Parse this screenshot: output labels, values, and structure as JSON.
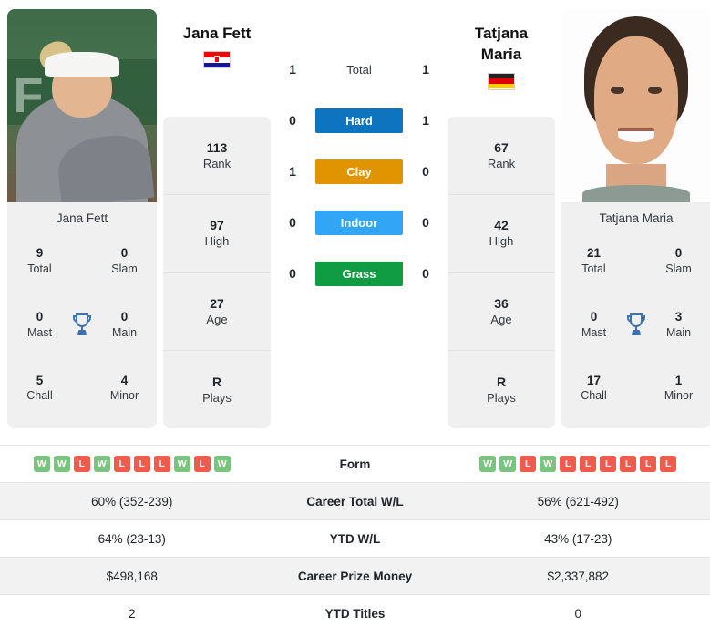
{
  "players": {
    "left": {
      "name": "Jana Fett",
      "card_name": "Jana Fett",
      "flag": "croatia-flag",
      "rank": "113",
      "rank_label": "Rank",
      "high": "97",
      "high_label": "High",
      "age": "27",
      "age_label": "Age",
      "plays": "R",
      "plays_label": "Plays",
      "titles": [
        {
          "value": "9",
          "label": "Total"
        },
        {
          "value": "0",
          "label": "Slam"
        },
        {
          "value": "0",
          "label": "Mast"
        },
        {
          "value": "0",
          "label": "Main"
        },
        {
          "value": "5",
          "label": "Chall"
        },
        {
          "value": "4",
          "label": "Minor"
        }
      ],
      "form": [
        "W",
        "W",
        "L",
        "W",
        "L",
        "L",
        "L",
        "W",
        "L",
        "W"
      ],
      "career_wl": "60% (352-239)",
      "ytd_wl": "64% (23-13)",
      "prize_money": "$498,168",
      "ytd_titles": "2"
    },
    "right": {
      "name": "Tatjana Maria",
      "name_line1": "Tatjana",
      "name_line2": "Maria",
      "card_name": "Tatjana Maria",
      "flag": "germany-flag",
      "rank": "67",
      "rank_label": "Rank",
      "high": "42",
      "high_label": "High",
      "age": "36",
      "age_label": "Age",
      "plays": "R",
      "plays_label": "Plays",
      "titles": [
        {
          "value": "21",
          "label": "Total"
        },
        {
          "value": "0",
          "label": "Slam"
        },
        {
          "value": "0",
          "label": "Mast"
        },
        {
          "value": "3",
          "label": "Main"
        },
        {
          "value": "17",
          "label": "Chall"
        },
        {
          "value": "1",
          "label": "Minor"
        }
      ],
      "form": [
        "W",
        "W",
        "L",
        "W",
        "L",
        "L",
        "L",
        "L",
        "L",
        "L"
      ],
      "career_wl": "56% (621-492)",
      "ytd_wl": "43% (17-23)",
      "prize_money": "$2,337,882",
      "ytd_titles": "0"
    }
  },
  "head_to_head": [
    {
      "label": "Total",
      "left": "1",
      "right": "1",
      "surface": false,
      "color": ""
    },
    {
      "label": "Hard",
      "left": "0",
      "right": "1",
      "surface": true,
      "color": "#0f74c0"
    },
    {
      "label": "Clay",
      "left": "1",
      "right": "0",
      "surface": true,
      "color": "#e09400"
    },
    {
      "label": "Indoor",
      "left": "0",
      "right": "0",
      "surface": true,
      "color": "#32a6f5"
    },
    {
      "label": "Grass",
      "left": "0",
      "right": "0",
      "surface": true,
      "color": "#109c42"
    }
  ],
  "stats_table": [
    {
      "label": "Form",
      "type": "form"
    },
    {
      "label": "Career Total W/L",
      "type": "text",
      "left_key": "career_wl",
      "right_key": "career_wl"
    },
    {
      "label": "YTD W/L",
      "type": "text",
      "left_key": "ytd_wl",
      "right_key": "ytd_wl"
    },
    {
      "label": "Career Prize Money",
      "type": "text",
      "left_key": "prize_money",
      "right_key": "prize_money"
    },
    {
      "label": "YTD Titles",
      "type": "text",
      "left_key": "ytd_titles",
      "right_key": "ytd_titles"
    }
  ],
  "icons": {
    "trophy": "trophy-icon"
  }
}
